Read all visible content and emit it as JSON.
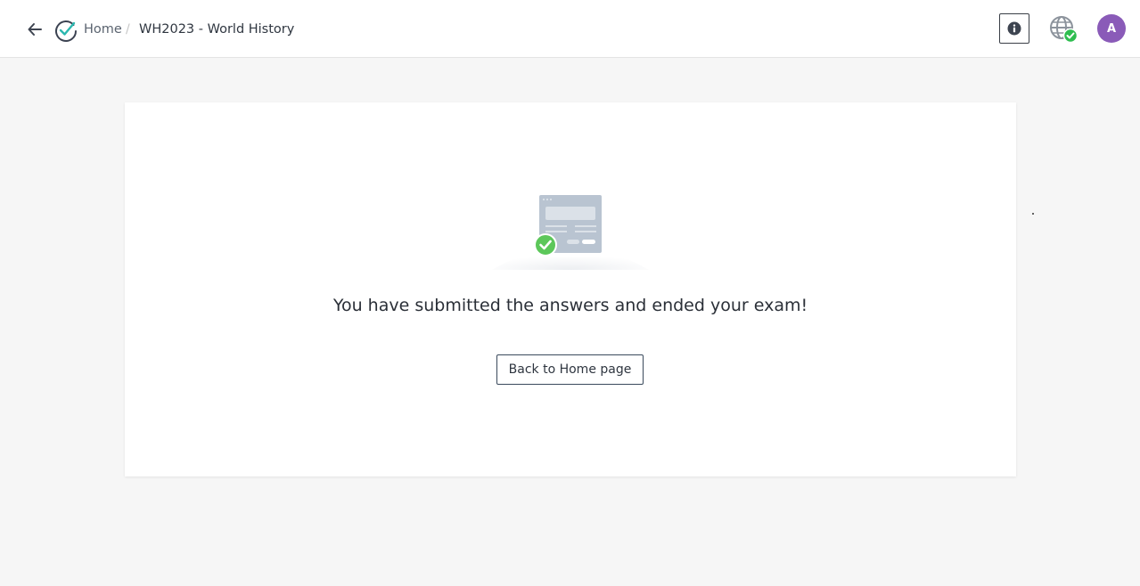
{
  "header": {
    "breadcrumb": {
      "home_label": "Home",
      "separator": "/",
      "current_label": "WH2023 - World History"
    },
    "icons": {
      "back": "arrow-left-icon",
      "logo": "check-circle-logo",
      "info": "info-icon",
      "connection": "globe-connected-icon"
    },
    "avatar_initial": "A",
    "colors": {
      "avatar": "#8a5bb8",
      "success": "#5cc75a"
    }
  },
  "main": {
    "message": "You have submitted the answers and ended your exam!",
    "back_button_label": "Back to Home page"
  }
}
